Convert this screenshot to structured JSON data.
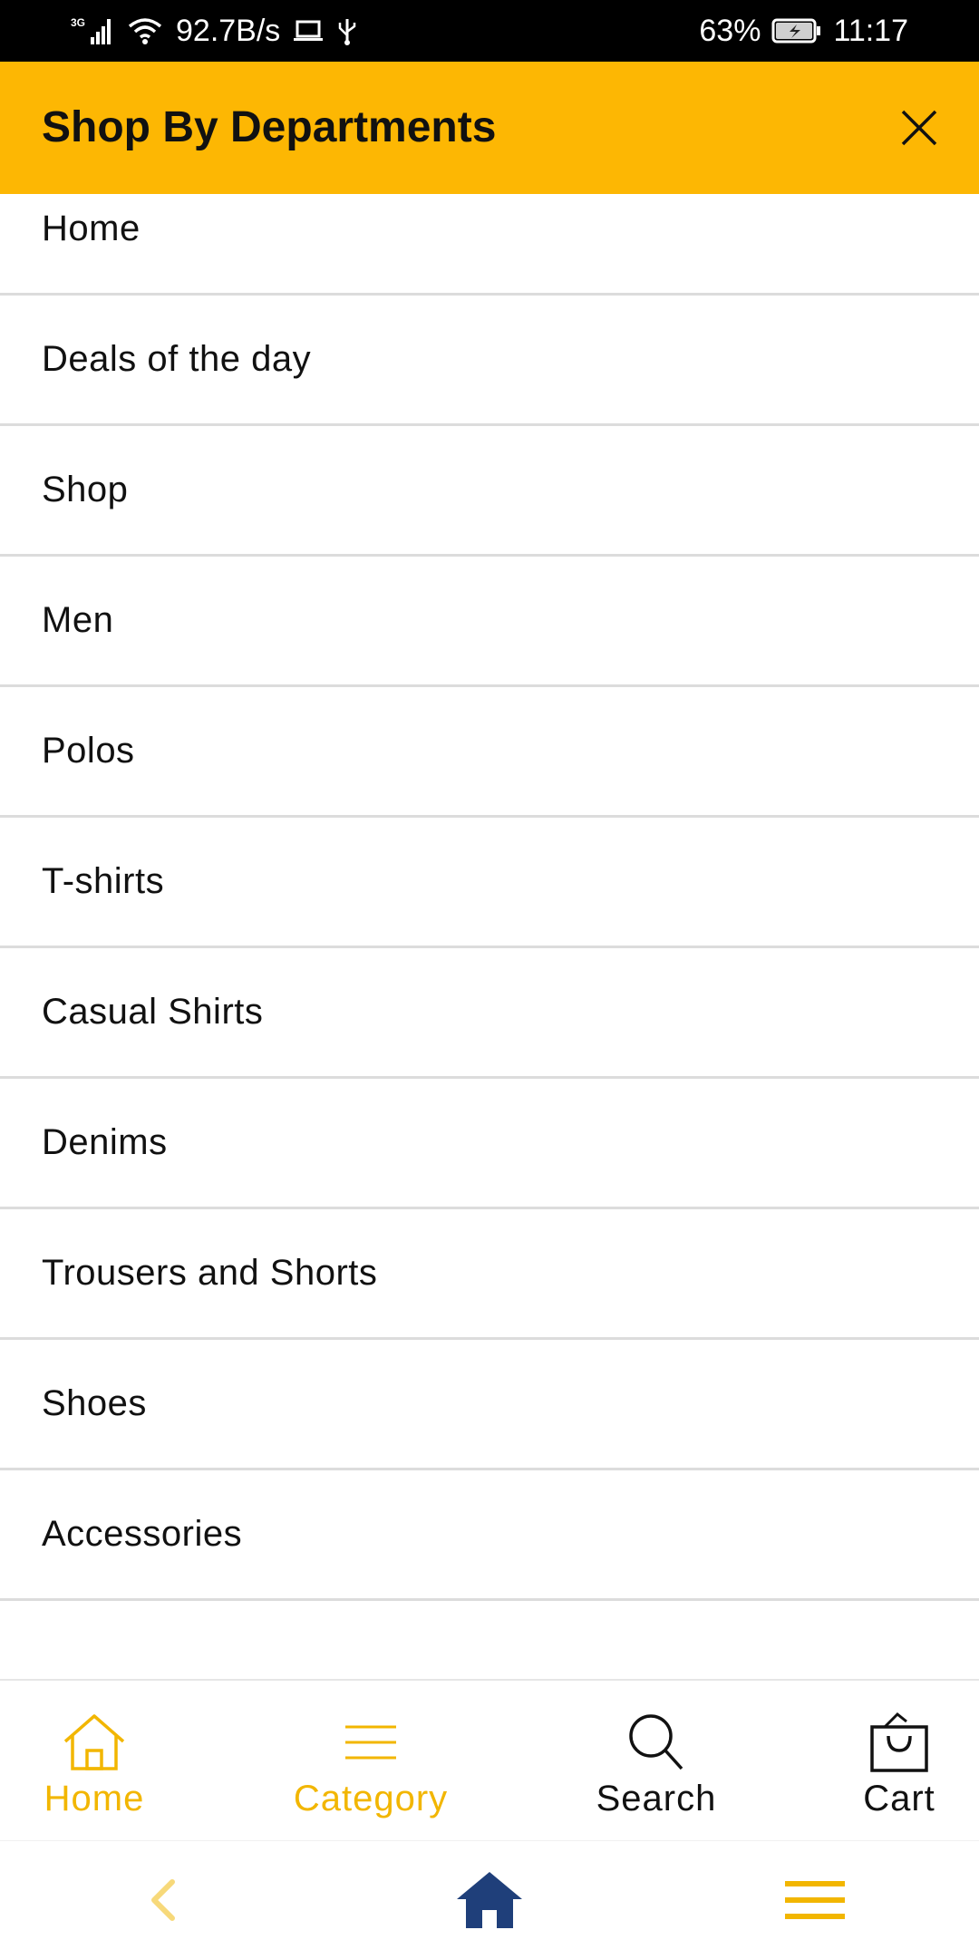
{
  "status_bar": {
    "network": "3G",
    "speed": "92.7B/s",
    "battery": "63%",
    "time": "11:17"
  },
  "header": {
    "title": "Shop By Departments"
  },
  "menu": {
    "items": [
      {
        "label": "Home"
      },
      {
        "label": "Deals of the day"
      },
      {
        "label": "Shop"
      },
      {
        "label": "Men"
      },
      {
        "label": "Polos"
      },
      {
        "label": "T-shirts"
      },
      {
        "label": "Casual Shirts"
      },
      {
        "label": "Denims"
      },
      {
        "label": "Trousers and Shorts"
      },
      {
        "label": "Shoes"
      },
      {
        "label": "Accessories"
      }
    ]
  },
  "tabbar": {
    "home": "Home",
    "category": "Category",
    "search": "Search",
    "cart": "Cart"
  },
  "colors": {
    "accent": "#FDB703",
    "active_tab": "#F2B600",
    "nav_home": "#1F3F7A"
  }
}
